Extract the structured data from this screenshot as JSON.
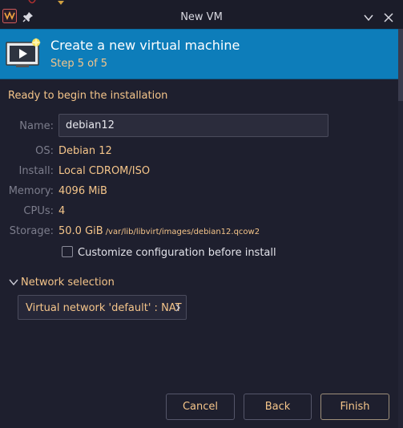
{
  "window": {
    "title": "New VM"
  },
  "banner": {
    "title": "Create a new virtual machine",
    "step": "Step 5 of 5"
  },
  "summary": {
    "intro": "Ready to begin the installation",
    "name_label": "Name:",
    "name_value": "debian12",
    "os_label": "OS:",
    "os_value": "Debian 12",
    "install_label": "Install:",
    "install_value": "Local CDROM/ISO",
    "memory_label": "Memory:",
    "memory_value": "4096 MiB",
    "cpus_label": "CPUs:",
    "cpus_value": "4",
    "storage_label": "Storage:",
    "storage_value": "50.0 GiB",
    "storage_path": "/var/lib/libvirt/images/debian12.qcow2"
  },
  "customize": {
    "label": "Customize configuration before install",
    "checked": false
  },
  "network": {
    "expander_label": "Network selection",
    "selected": "Virtual network 'default' : NAT"
  },
  "buttons": {
    "cancel": "Cancel",
    "back": "Back",
    "finish": "Finish"
  },
  "icons": {
    "app": "virt-manager-icon",
    "pin": "pin-icon",
    "minimize": "chevron-down-icon",
    "close": "close-icon",
    "banner": "vm-screen-icon"
  },
  "colors": {
    "banner_bg": "#0d7dba",
    "accent_text": "#f5c58a",
    "window_bg": "#1e1f2e"
  }
}
